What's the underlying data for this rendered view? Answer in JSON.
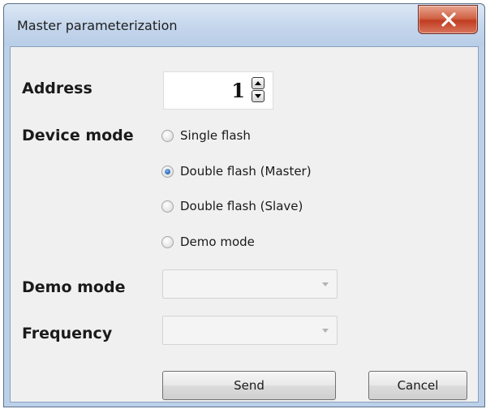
{
  "window": {
    "title": "Master parameterization"
  },
  "address": {
    "label": "Address",
    "value": "1"
  },
  "device_mode": {
    "label": "Device mode",
    "options": [
      {
        "label": "Single flash",
        "selected": false
      },
      {
        "label": "Double flash (Master)",
        "selected": true
      },
      {
        "label": "Double flash (Slave)",
        "selected": false
      },
      {
        "label": "Demo mode",
        "selected": false
      }
    ]
  },
  "demo_mode": {
    "label": "Demo mode",
    "value": "",
    "enabled": false
  },
  "frequency": {
    "label": "Frequency",
    "value": "",
    "enabled": false
  },
  "buttons": {
    "send": "Send",
    "cancel": "Cancel"
  },
  "icons": {
    "close": "close-icon",
    "spin_up": "arrow-up-icon",
    "spin_down": "arrow-down-icon",
    "dropdown": "chevron-down-icon"
  },
  "colors": {
    "titlebar": "#c4d6ec",
    "close_button": "#c13d22",
    "client_background": "#f0f0f0",
    "radio_selected": "#2a66b5"
  }
}
